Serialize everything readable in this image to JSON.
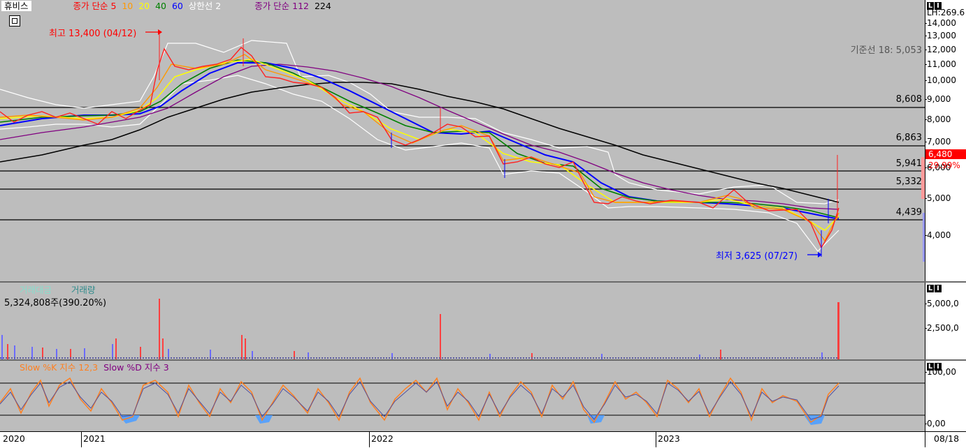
{
  "header": {
    "stock_name": "휴비스",
    "ma_label": "종가 단순",
    "ma_periods": [
      "5",
      "10",
      "20",
      "40",
      "60"
    ],
    "ma_colors": [
      "#ff3030",
      "#ff9900",
      "#ffff00",
      "#008000",
      "#0000ff"
    ],
    "upper_limit_label": "상한선 2",
    "long_ma_label": "종가 단순 112",
    "long_ma2": "224"
  },
  "price_pane": {
    "high_marker": "최고 13,400 (04/12)",
    "low_marker": "최저 3,625 (07/27)",
    "ichimoku_base": "기준선 18: 5,053",
    "h_lines": [
      "8,608",
      "6,863",
      "5,941",
      "5,332",
      "4,439"
    ],
    "current_price": "6,480",
    "current_change": "29.99%",
    "axis_header": "LH:269.6",
    "axis_ticks": [
      "14,000",
      "13,000",
      "12,000",
      "11,000",
      "10,000",
      "9,000",
      "8,000",
      "7,000",
      "6,000",
      "5,000",
      "4,000"
    ]
  },
  "volume_pane": {
    "label_amount": "거래대금",
    "label_volume": "거래량",
    "current": "5,324,808주(390.20%)",
    "axis_ticks": [
      "5,000,0",
      "2,500,0"
    ]
  },
  "stoch_pane": {
    "k_label": "Slow %K 지수 12,3",
    "d_label": "Slow %D 지수 3",
    "axis_ticks": [
      "100,00",
      "0,00"
    ]
  },
  "x_axis": {
    "labels": [
      "2020",
      "2021",
      "2022",
      "2023"
    ],
    "last_date": "08/18"
  },
  "chart_data": {
    "type": "line",
    "title": "휴비스",
    "x": [
      "2020",
      "2021",
      "2022",
      "2023",
      "08/18"
    ],
    "series": [
      {
        "name": "종가 단순 5",
        "values": [
          8400,
          8300,
          9500,
          6500,
          4500
        ]
      },
      {
        "name": "종가 단순 224",
        "values": [
          7200,
          8000,
          9900,
          7300,
          4800
        ]
      }
    ],
    "ylim": [
      3500,
      14500
    ],
    "highlights": {
      "high": 13400,
      "low": 3625,
      "last": 6480
    }
  }
}
